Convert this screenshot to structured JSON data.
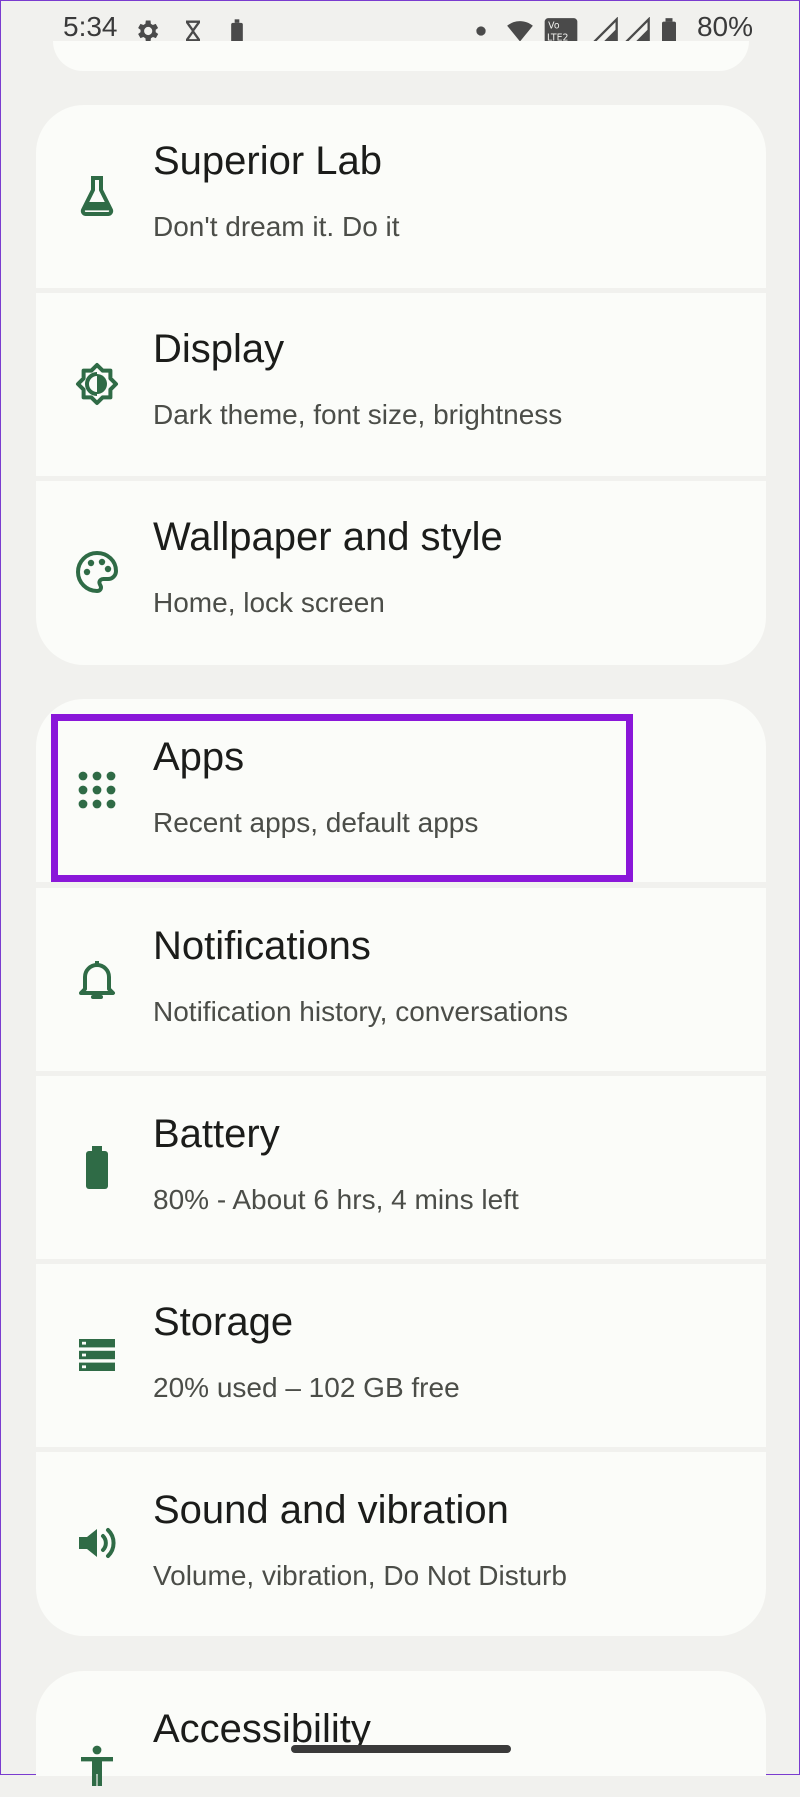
{
  "status_bar": {
    "time": "5:34",
    "battery": "80%",
    "icons": [
      "gear-icon",
      "hourglass-icon",
      "battery-saver-icon",
      "dot-icon",
      "wifi-icon",
      "volte-icon",
      "signal-icon",
      "signal-icon",
      "battery-icon"
    ]
  },
  "settings": [
    {
      "title": "Superior Lab",
      "subtitle": "Don't dream it. Do it",
      "icon": "flask-icon"
    },
    {
      "title": "Display",
      "subtitle": "Dark theme, font size, brightness",
      "icon": "brightness-icon"
    },
    {
      "title": "Wallpaper and style",
      "subtitle": "Home, lock screen",
      "icon": "palette-icon"
    },
    {
      "title": "Apps",
      "subtitle": "Recent apps, default apps",
      "icon": "apps-grid-icon"
    },
    {
      "title": "Notifications",
      "subtitle": "Notification history, conversations",
      "icon": "bell-icon"
    },
    {
      "title": "Battery",
      "subtitle": "80% - About 6 hrs, 4 mins left",
      "icon": "battery-icon"
    },
    {
      "title": "Storage",
      "subtitle": "20% used – 102 GB free",
      "icon": "storage-icon"
    },
    {
      "title": "Sound and vibration",
      "subtitle": "Volume, vibration, Do Not Disturb",
      "icon": "speaker-icon"
    },
    {
      "title": "Accessibility",
      "icon": "accessibility-icon"
    }
  ],
  "colors": {
    "accent_icon": "#2f6b46",
    "highlight": "#8a17d9",
    "card_bg": "#fbfcf9",
    "page_bg": "#f1f1ee"
  }
}
